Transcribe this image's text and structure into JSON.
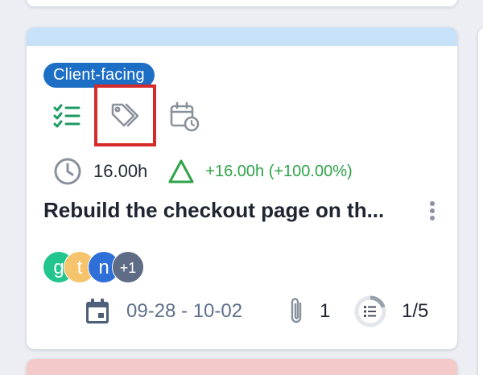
{
  "card": {
    "color_bar": "#c7e1f9",
    "tag": {
      "label": "Client-facing",
      "color": "#1d6fc6"
    },
    "toolbar": {
      "checklist_icon": "checklist-icon",
      "tags_icon": "tags-icon",
      "calendar_icon": "calendar-clock-icon"
    },
    "time": {
      "logged": "16.00h",
      "delta": "+16.00h (+100.00%)",
      "delta_color": "#2fa34a"
    },
    "title": "Rebuild the checkout page on th...",
    "assignees": [
      {
        "initial": "g",
        "color": "#22c58e"
      },
      {
        "initial": "t",
        "color": "#f5c46d"
      },
      {
        "initial": "n",
        "color": "#2f6fd8"
      }
    ],
    "assignees_more": "+1",
    "footer": {
      "date_range": "09-28 - 10-02",
      "attachments": "1",
      "checklist_progress": "1/5",
      "checklist_fraction": 0.2
    }
  },
  "neighbors": {
    "below_card_color": "#f4c9c9"
  }
}
